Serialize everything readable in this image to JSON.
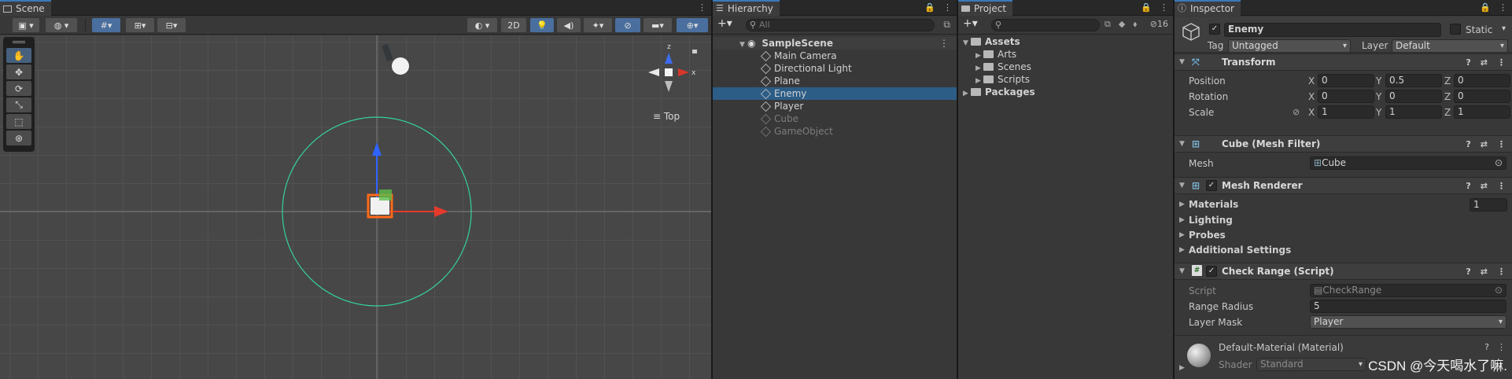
{
  "scene": {
    "tab": "Scene",
    "toolbar": {
      "mode_2d": "2D"
    },
    "view_label": "Top",
    "gizmo_axes": {
      "y": "y",
      "z": "z",
      "x": "x"
    }
  },
  "hierarchy": {
    "tab": "Hierarchy",
    "search_placeholder": "All",
    "scene_name": "SampleScene",
    "items": [
      {
        "label": "Main Camera",
        "selected": false,
        "dim": false
      },
      {
        "label": "Directional Light",
        "selected": false,
        "dim": false
      },
      {
        "label": "Plane",
        "selected": false,
        "dim": false
      },
      {
        "label": "Enemy",
        "selected": true,
        "dim": false
      },
      {
        "label": "Player",
        "selected": false,
        "dim": false
      },
      {
        "label": "Cube",
        "selected": false,
        "dim": true
      },
      {
        "label": "GameObject",
        "selected": false,
        "dim": true
      }
    ]
  },
  "project": {
    "tab": "Project",
    "hidden_count": "16",
    "assets": "Assets",
    "folders": [
      "Arts",
      "Scenes",
      "Scripts"
    ],
    "packages": "Packages"
  },
  "inspector": {
    "tab": "Inspector",
    "object_name": "Enemy",
    "static_label": "Static",
    "tag_label": "Tag",
    "tag_value": "Untagged",
    "layer_label": "Layer",
    "layer_value": "Default",
    "transform": {
      "title": "Transform",
      "position_label": "Position",
      "rotation_label": "Rotation",
      "scale_label": "Scale",
      "axis_x": "X",
      "axis_y": "Y",
      "axis_z": "Z",
      "position": [
        "0",
        "0.5",
        "0"
      ],
      "rotation": [
        "0",
        "0",
        "0"
      ],
      "scale": [
        "1",
        "1",
        "1"
      ]
    },
    "mesh_filter": {
      "title": "Cube (Mesh Filter)",
      "mesh_label": "Mesh",
      "mesh_value": "Cube"
    },
    "mesh_renderer": {
      "title": "Mesh Renderer",
      "materials_label": "Materials",
      "materials_count": "1",
      "lighting": "Lighting",
      "probes": "Probes",
      "additional": "Additional Settings"
    },
    "check_range": {
      "title": "Check Range (Script)",
      "script_label": "Script",
      "script_value": "CheckRange",
      "range_label": "Range Radius",
      "range_value": "5",
      "mask_label": "Layer Mask",
      "mask_value": "Player"
    },
    "material": {
      "title": "Default-Material (Material)",
      "shader_label": "Shader",
      "shader_value": "Standard"
    }
  },
  "watermark": "CSDN @今天喝水了嘛."
}
